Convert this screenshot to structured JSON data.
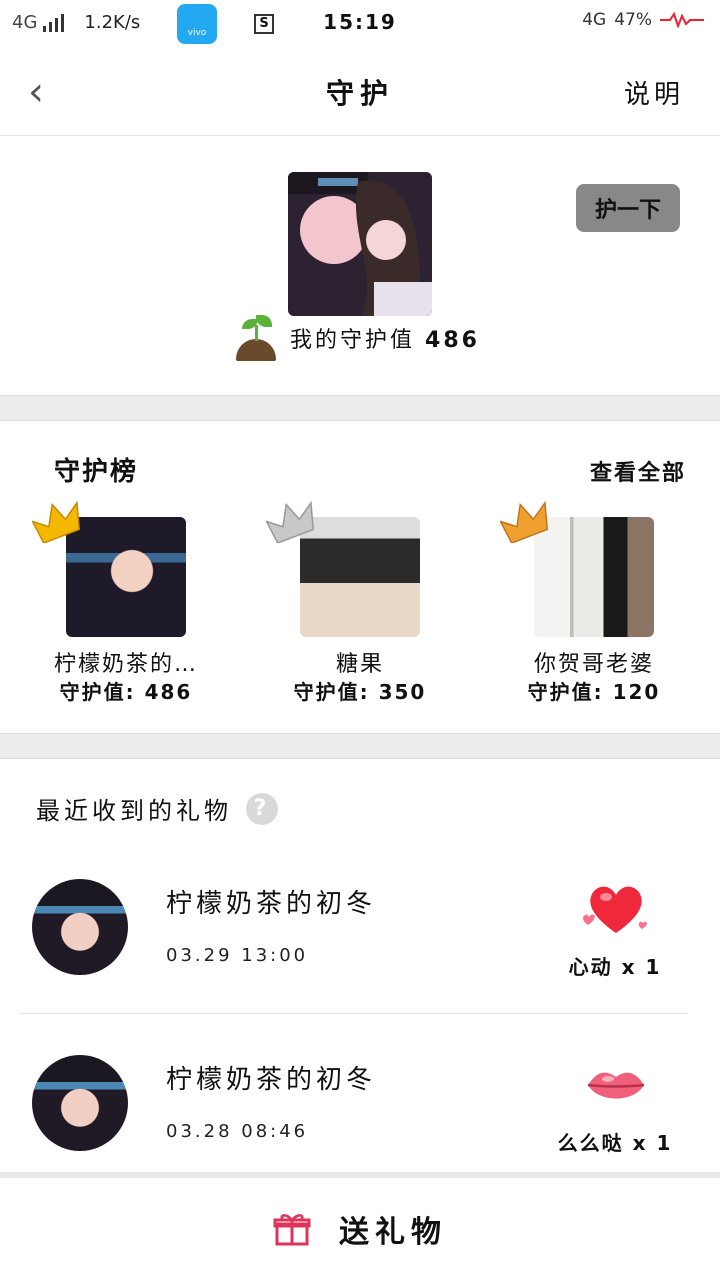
{
  "status_bar": {
    "network": "4G",
    "speed": "1.2K/s",
    "vivo_label": "vivo",
    "sim_icon": "S",
    "time": "15:19",
    "network_right": "4G",
    "battery": "47%"
  },
  "header": {
    "back_icon": "‹",
    "title": "守护",
    "explain": "说明"
  },
  "profile": {
    "guard_button": "护一下",
    "my_value_label": "我的守护值",
    "my_value": "486"
  },
  "ranking": {
    "title": "守护榜",
    "view_all": "查看全部",
    "crown_colors": [
      "#f5b800",
      "#bfbfbf",
      "#f0a030"
    ],
    "items": [
      {
        "name": "柠檬奶茶的…",
        "score": "守护值: 486"
      },
      {
        "name": "糖果",
        "score": "守护值: 350"
      },
      {
        "name": "你贺哥老婆",
        "score": "守护值: 120"
      }
    ]
  },
  "gifts": {
    "title": "最近收到的礼物",
    "help_icon": "?",
    "items": [
      {
        "name": "柠檬奶茶的初冬",
        "time": "03.29 13:00",
        "gift": "心动 x 1",
        "icon": "heart-icon"
      },
      {
        "name": "柠檬奶茶的初冬",
        "time": "03.28 08:46",
        "gift": "么么哒 x 1",
        "icon": "lips-icon"
      }
    ]
  },
  "bottom": {
    "send_label": "送礼物",
    "accent": "#e0335a"
  }
}
